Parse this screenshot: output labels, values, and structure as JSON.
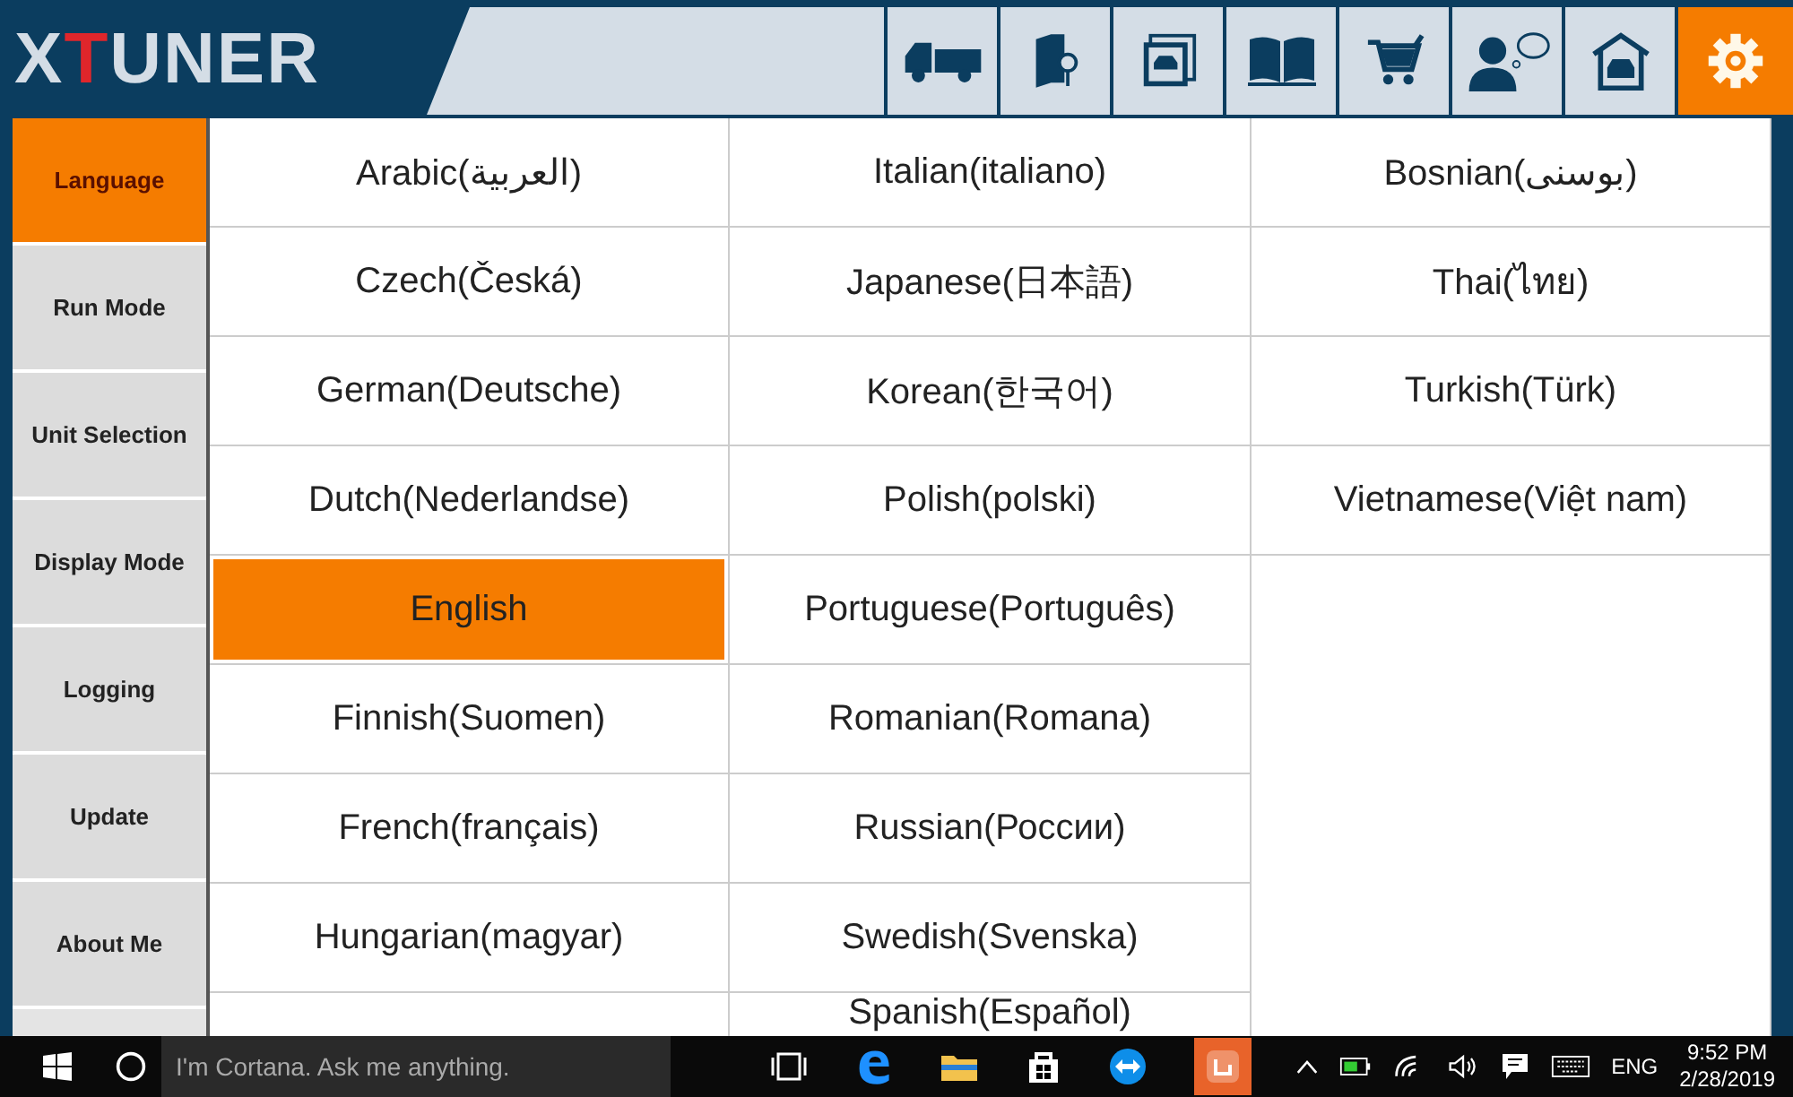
{
  "logo": {
    "text": "XTUNER"
  },
  "toolbar": [
    {
      "selected": false
    },
    {
      "selected": false
    },
    {
      "selected": false
    },
    {
      "selected": false
    },
    {
      "selected": false
    },
    {
      "selected": false
    },
    {
      "selected": false
    },
    {
      "selected": true
    }
  ],
  "sidebar": {
    "items": [
      {
        "label": "Language",
        "selected": true
      },
      {
        "label": "Run Mode",
        "selected": false
      },
      {
        "label": "Unit Selection",
        "selected": false
      },
      {
        "label": "Display Mode",
        "selected": false
      },
      {
        "label": "Logging",
        "selected": false
      },
      {
        "label": "Update",
        "selected": false
      },
      {
        "label": "About Me",
        "selected": false
      }
    ]
  },
  "languages": {
    "columns": [
      [
        {
          "label": "Arabic(العربية)",
          "selected": false
        },
        {
          "label": "Czech(Česká)",
          "selected": false
        },
        {
          "label": "German(Deutsche)",
          "selected": false
        },
        {
          "label": "Dutch(Nederlandse)",
          "selected": false
        },
        {
          "label": "English",
          "selected": true
        },
        {
          "label": "Finnish(Suomen)",
          "selected": false
        },
        {
          "label": "French(français)",
          "selected": false
        },
        {
          "label": "Hungarian(magyar)",
          "selected": false
        }
      ],
      [
        {
          "label": "Italian(italiano)",
          "selected": false
        },
        {
          "label": "Japanese(日本語)",
          "selected": false
        },
        {
          "label": "Korean(한국어)",
          "selected": false
        },
        {
          "label": "Polish(polski)",
          "selected": false
        },
        {
          "label": "Portuguese(Português)",
          "selected": false
        },
        {
          "label": "Romanian(Romana)",
          "selected": false
        },
        {
          "label": "Russian(России)",
          "selected": false
        },
        {
          "label": "Swedish(Svenska)",
          "selected": false
        },
        {
          "label": "Spanish(Español)",
          "selected": false
        }
      ],
      [
        {
          "label": "Bosnian(بوسنى)",
          "selected": false
        },
        {
          "label": "Thai(ไทย)",
          "selected": false
        },
        {
          "label": "Turkish(Türk)",
          "selected": false
        },
        {
          "label": "Vietnamese(Việt nam)",
          "selected": false
        }
      ]
    ]
  },
  "taskbar": {
    "search": {
      "placeholder": "I'm Cortana. Ask me anything."
    },
    "language": "ENG",
    "time": "9:52 PM",
    "date": "2/28/2019"
  }
}
